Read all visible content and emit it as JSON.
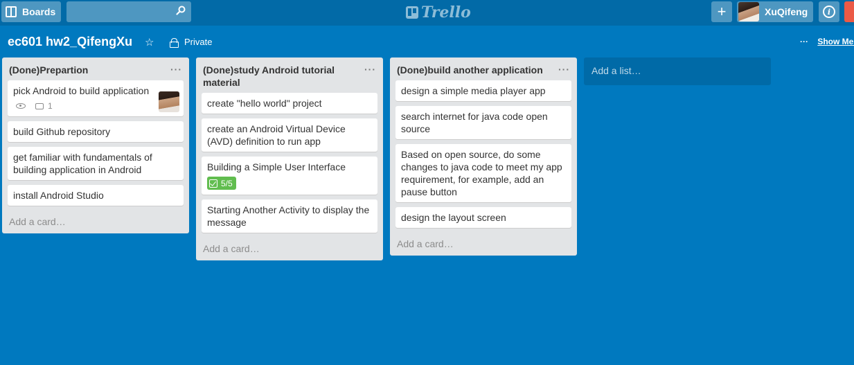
{
  "header": {
    "boards_label": "Boards",
    "logo_text": "Trello",
    "add_label": "+",
    "member_name": "XuQifeng",
    "info_label": "i"
  },
  "board": {
    "title": "ec601 hw2_QifengXu",
    "visibility": "Private",
    "show_menu": "Show Menu"
  },
  "lists": [
    {
      "title": "(Done)Prepartion",
      "cards": [
        {
          "text": "pick Android to build application",
          "comments": "1"
        },
        {
          "text": "build Github repository"
        },
        {
          "text": "get familiar with fundamentals of building application in Android"
        },
        {
          "text": "install Android Studio"
        }
      ],
      "add_card": "Add a card…"
    },
    {
      "title": "(Done)study Android tutorial material",
      "cards": [
        {
          "text": "create \"hello world\" project"
        },
        {
          "text": "create an Android Virtual Device (AVD) definition to run app"
        },
        {
          "text": "Building a Simple User Interface",
          "checklist": "5/5"
        },
        {
          "text": "Starting Another Activity to display the message"
        }
      ],
      "add_card": "Add a card…"
    },
    {
      "title": "(Done)build another application",
      "cards": [
        {
          "text": "design a simple media player app"
        },
        {
          "text": "search internet for java code open source"
        },
        {
          "text": "Based on open source, do some changes to java code to meet my app requirement, for example, add an pause button"
        },
        {
          "text": "design the layout screen"
        }
      ],
      "add_card": "Add a card…"
    }
  ],
  "add_list": "Add a list…",
  "colors": {
    "board_bg": "#0079bf",
    "header_bg": "#026aa7",
    "list_bg": "#e2e4e6",
    "checklist_done": "#61bd4f",
    "notification": "#eb5a46"
  }
}
